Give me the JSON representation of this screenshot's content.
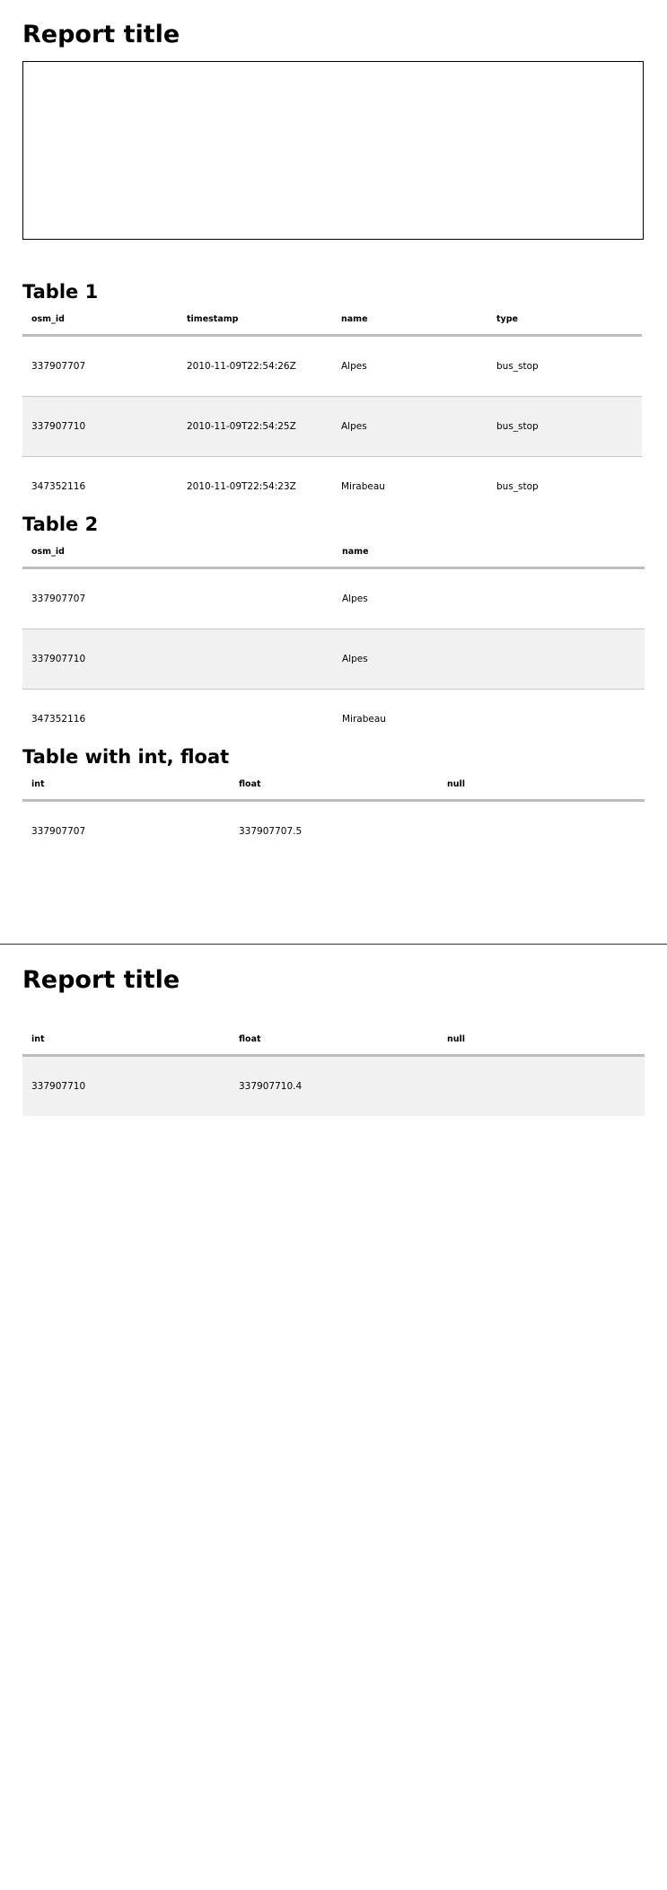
{
  "report_title": "Report title",
  "table1": {
    "heading": "Table 1",
    "columns": [
      "osm_id",
      "timestamp",
      "name",
      "type"
    ],
    "rows": [
      [
        "337907707",
        "2010-11-09T22:54:26Z",
        "Alpes",
        "bus_stop"
      ],
      [
        "337907710",
        "2010-11-09T22:54:25Z",
        "Alpes",
        "bus_stop"
      ],
      [
        "347352116",
        "2010-11-09T22:54:23Z",
        "Mirabeau",
        "bus_stop"
      ]
    ]
  },
  "table2": {
    "heading": "Table 2",
    "columns": [
      "osm_id",
      "name"
    ],
    "rows": [
      [
        "337907707",
        "Alpes"
      ],
      [
        "337907710",
        "Alpes"
      ],
      [
        "347352116",
        "Mirabeau"
      ]
    ]
  },
  "table3": {
    "heading": "Table with int, float",
    "columns": [
      "int",
      "float",
      "null"
    ],
    "rows": [
      [
        "337907707",
        "337907707.5",
        ""
      ]
    ]
  },
  "page2": {
    "report_title": "Report title",
    "table": {
      "columns": [
        "int",
        "float",
        "null"
      ],
      "rows": [
        [
          "337907710",
          "337907710.4",
          ""
        ]
      ]
    }
  }
}
